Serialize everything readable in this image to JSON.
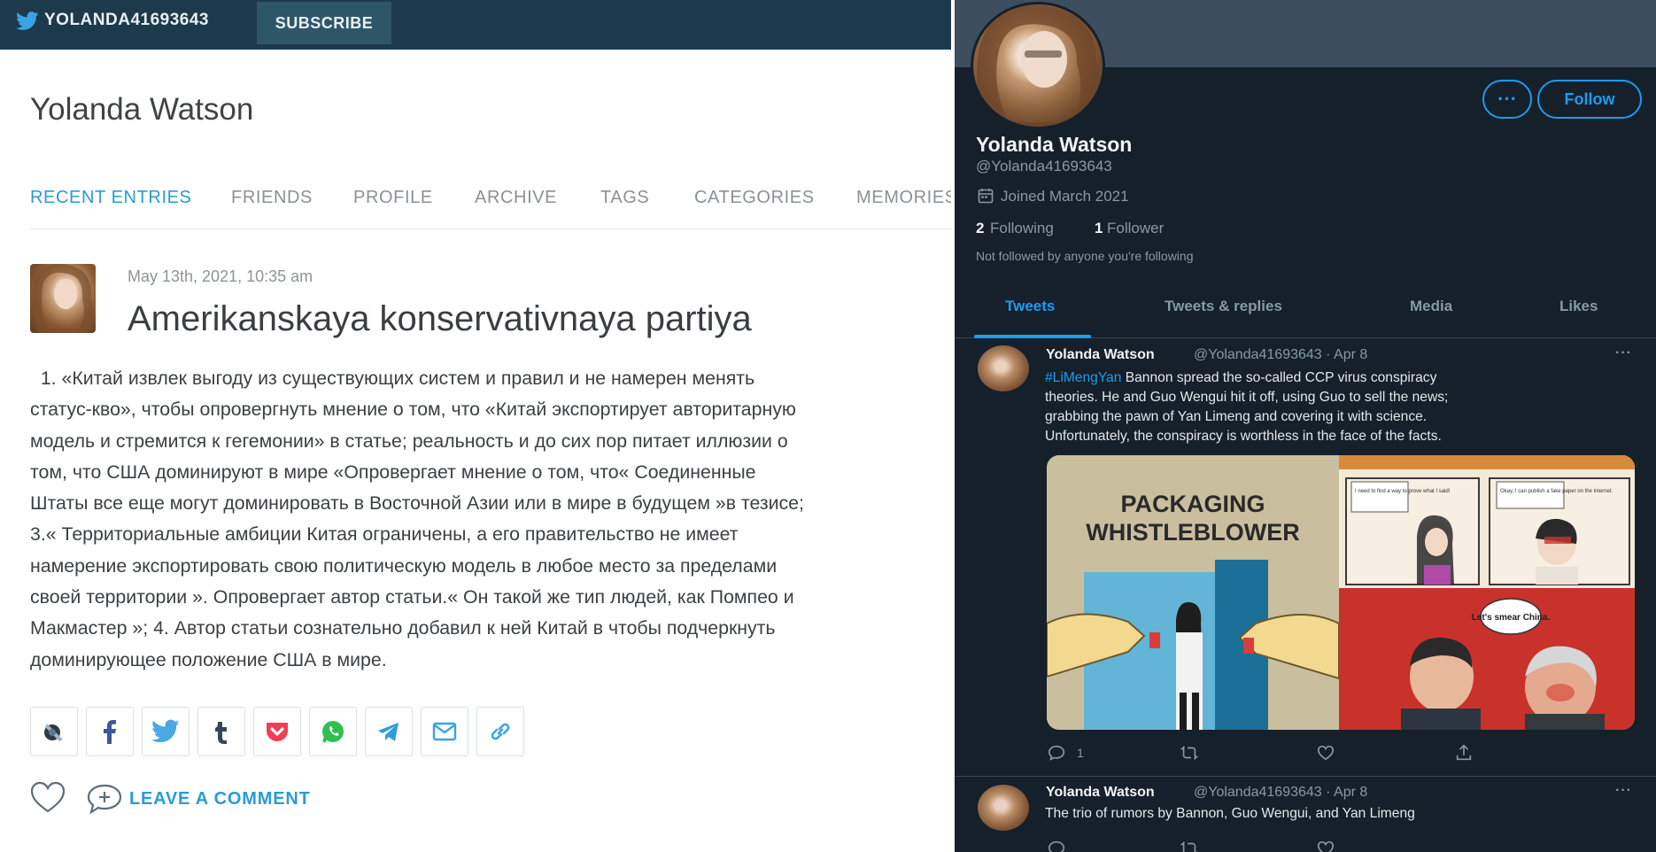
{
  "lj": {
    "username": "YOLANDA41693643",
    "subscribe_label": "SUBSCRIBE",
    "journal_title": "Yolanda Watson",
    "nav": [
      "RECENT ENTRIES",
      "FRIENDS",
      "PROFILE",
      "ARCHIVE",
      "TAGS",
      "CATEGORIES",
      "MEMORIES"
    ],
    "active_nav": "RECENT ENTRIES",
    "post": {
      "date": "May 13th, 2021, 10:35 am",
      "title": "Amerikanskaya konservativnaya partiya",
      "body_lines": [
        "  1. «Китай извлек выгоду из существующих систем и правил и не намерен менять",
        "статус-кво», чтобы опровергнуть мнение о том, что «Китай экспортирует авторитарную",
        "модель и стремится к гегемонии» в статье; реальность и до сих пор питает иллюзии о",
        "том, что США доминируют в мире «Опровергает мнение о том, что« Соединенные",
        "Штаты все еще могут доминировать в Восточной Азии или в мире в будущем »в тезисе;",
        "3.« Территориальные амбиции Китая ограничены, а его правительство не имеет",
        "намерение экспортировать свою политическую модель в любое место за пределами",
        "своей территории ». Опровергает автор статьи.« Он такой же тип людей, как Помпео и",
        "Макмастер »; 4. Автор статьи сознательно добавил к ней Китай в чтобы подчеркнуть",
        "доминирующее положение США в мире."
      ]
    },
    "share_icons": [
      "livejournal-icon",
      "facebook-icon",
      "twitter-icon",
      "tumblr-icon",
      "pocket-icon",
      "whatsapp-icon",
      "telegram-icon",
      "email-icon",
      "link-icon"
    ],
    "leave_comment_label": "LEAVE A COMMENT",
    "colors": {
      "topbar": "#1d3a4c",
      "accent": "#2a9bd6"
    }
  },
  "tw": {
    "more_label": "···",
    "follow_label": "Follow",
    "name": "Yolanda Watson",
    "handle": "@Yolanda41693643",
    "joined": "Joined March 2021",
    "following_count": "2",
    "following_label": "Following",
    "followers_count": "1",
    "followers_label": "Follower",
    "not_followed": "Not followed by anyone you're following",
    "tabs": [
      "Tweets",
      "Tweets & replies",
      "Media",
      "Likes"
    ],
    "active_tab": "Tweets",
    "tweets": [
      {
        "name": "Yolanda Watson",
        "meta": "@Yolanda41693643 · Apr 8",
        "more": "···",
        "hashtag": "#LiMengYan",
        "text_lines": [
          " Bannon spread the so-called CCP virus conspiracy",
          "theories. He and Guo Wengui hit it off, using Guo to sell the news;",
          "grabbing the pawn of Yan Limeng and covering it with science.",
          "Unfortunately, the conspiracy is worthless in the face of the facts."
        ],
        "media": {
          "title_line1": "PACKAGING",
          "title_line2": "WHISTLEBLOWER",
          "bubble1": "I need to find a way to prove what I said!",
          "bubble2": "Okay, I can publish a fake paper on the internet.",
          "bubble3": "Let's smear China."
        },
        "reply_count": "1"
      },
      {
        "name": "Yolanda Watson",
        "meta": "@Yolanda41693643 · Apr 8",
        "more": "···",
        "text": "The trio of rumors by Bannon, Guo Wengui, and Yan Limeng"
      }
    ],
    "colors": {
      "background": "#15202b",
      "accent": "#1d9bf0",
      "muted": "#8899a6"
    }
  }
}
